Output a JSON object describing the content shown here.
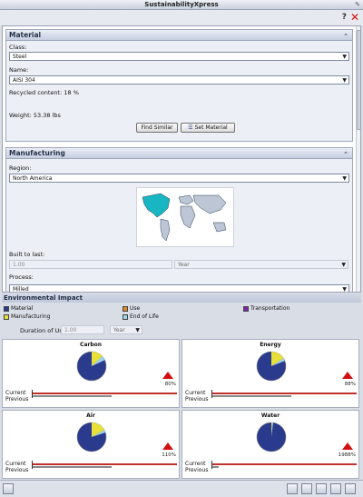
{
  "window": {
    "title": "SustainabilityXpress"
  },
  "material": {
    "section_title": "Material",
    "class_label": "Class:",
    "class_value": "Steel",
    "name_label": "Name:",
    "name_value": "AISI 304",
    "recycled_label": "Recycled content:",
    "recycled_value": "18 %",
    "weight_label": "Weight:",
    "weight_value": "53.38 lbs",
    "find_similar_label": "Find Similar",
    "set_material_label": "Set Material"
  },
  "manufacturing": {
    "section_title": "Manufacturing",
    "region_label": "Region:",
    "region_value": "North America",
    "built_label": "Built to last:",
    "built_value": "1.00",
    "built_unit": "Year",
    "process_label": "Process:",
    "process_value": "Milled"
  },
  "environmental": {
    "section_title": "Environmental Impact",
    "legend": [
      {
        "label": "Material",
        "color": "#2a3a8c"
      },
      {
        "label": "Use",
        "color": "#e08a2a"
      },
      {
        "label": "Transportation",
        "color": "#7a2aa8"
      },
      {
        "label": "Manufacturing",
        "color": "#e8e038"
      },
      {
        "label": "End of Life",
        "color": "#9ed4ee"
      }
    ],
    "duration_label": "Duration of Use :",
    "duration_value": "1.00",
    "duration_unit": "Year",
    "cards": [
      {
        "title": "Carbon",
        "pct": "80%",
        "current_label": "Current",
        "previous_label": "Previous",
        "current_frac": 1.0,
        "previous_frac": 0.55,
        "manufacturing_frac": 0.13,
        "eol_frac": 0.05
      },
      {
        "title": "Energy",
        "pct": "88%",
        "current_label": "Current",
        "previous_label": "Previous",
        "current_frac": 1.0,
        "previous_frac": 0.55,
        "manufacturing_frac": 0.16,
        "eol_frac": 0.03
      },
      {
        "title": "Air",
        "pct": "110%",
        "current_label": "Current",
        "previous_label": "Previous",
        "current_frac": 1.0,
        "previous_frac": 0.55,
        "manufacturing_frac": 0.17,
        "eol_frac": 0.03
      },
      {
        "title": "Water",
        "pct": "1988%",
        "current_label": "Current",
        "previous_label": "Previous",
        "current_frac": 1.0,
        "previous_frac": 0.05,
        "manufacturing_frac": 0.01,
        "eol_frac": 0.01
      }
    ]
  },
  "colors": {
    "accent_red": "#d01010",
    "pie_blue": "#2a3a8c"
  }
}
